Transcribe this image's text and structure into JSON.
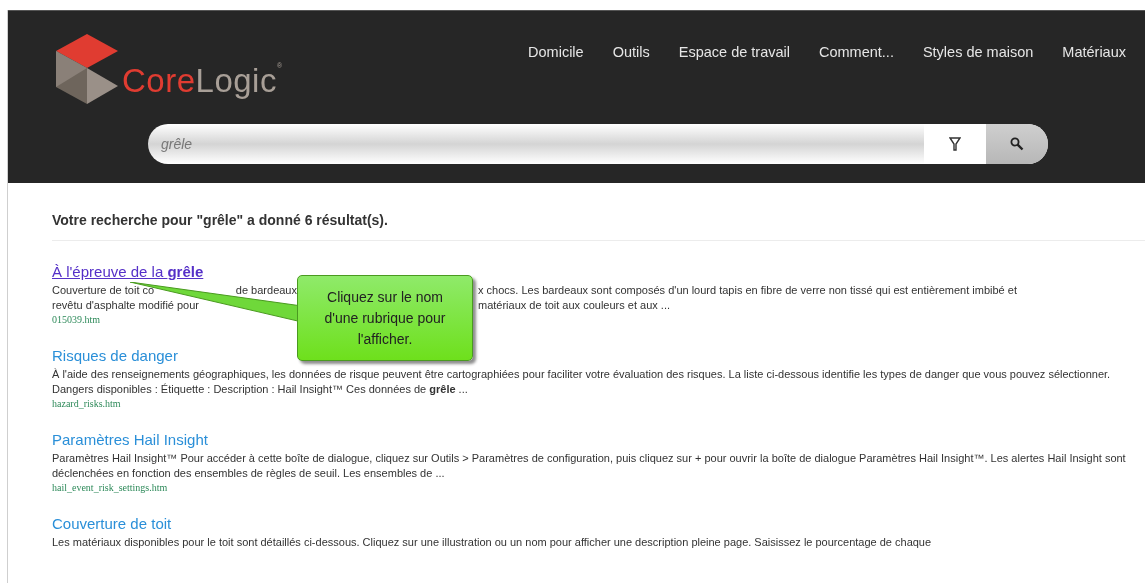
{
  "logo": {
    "parts": [
      "Core",
      "Logic"
    ],
    "mark": "®"
  },
  "nav": [
    "Domicile",
    "Outils",
    "Espace de travail",
    "Comment...",
    "Styles de maison",
    "Matériaux"
  ],
  "search": {
    "value": "grêle"
  },
  "summary": "Votre recherche pour \"grêle\" a donné 6 résultat(s).",
  "results": [
    {
      "kind": "covered",
      "title": "À l'épreuve de la **grêle**",
      "visited": true,
      "lines": [
        [
          "Couverture de toit co",
          "de bardeaux",
          "x chocs. Les bardeaux sont composés d'un lourd tapis en fibre de verre non tissé qui est entièrement imbibé et"
        ],
        [
          "revêtu d'asphalte modifié pour",
          "matériaux de toit aux couleurs et aux ..."
        ]
      ],
      "url": "015039.htm"
    },
    {
      "kind": "plain",
      "title": "Risques de danger",
      "visited": false,
      "description": "À l'aide des renseignements géographiques, les données de risque peuvent être cartographiées pour faciliter votre évaluation des risques. La liste ci-dessous identifie les types de danger que vous pouvez sélectionner. Dangers disponibles : Étiquette : Description : Hail Insight™ Ces données de **grêle** ...",
      "url": "hazard_risks.htm"
    },
    {
      "kind": "plain",
      "title": "Paramètres Hail Insight",
      "visited": false,
      "description": "Paramètres Hail Insight™ Pour accéder à cette boîte de dialogue, cliquez sur Outils > Paramètres de configuration, puis cliquez sur + pour ouvrir la boîte de dialogue Paramètres Hail Insight™. Les alertes Hail Insight sont déclenchées en fonction des ensembles de règles de seuil. Les ensembles de ...",
      "url": "hail_event_risk_settings.htm"
    },
    {
      "kind": "plain",
      "title": "Couverture de toit",
      "visited": false,
      "description": "Les matériaux disponibles pour le toit sont détaillés ci-dessous. Cliquez sur une illustration ou un nom pour afficher une description pleine page. Saisissez le pourcentage de chaque"
    }
  ],
  "callout": "Cliquez sur le nom d'une rubrique pour l'afficher."
}
